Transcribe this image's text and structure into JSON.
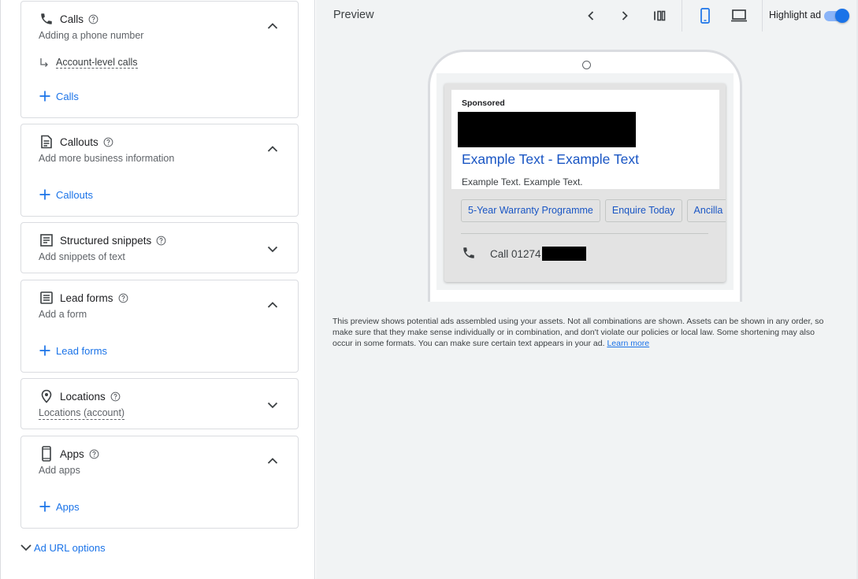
{
  "assets": {
    "calls": {
      "title": "Calls",
      "subtitle": "Adding a phone number",
      "sub_link": "Account-level calls",
      "add_label": "Calls"
    },
    "callouts": {
      "title": "Callouts",
      "subtitle": "Add more business information",
      "add_label": "Callouts"
    },
    "structured_snippets": {
      "title": "Structured snippets",
      "subtitle": "Add snippets of text"
    },
    "lead_forms": {
      "title": "Lead forms",
      "subtitle": "Add a form",
      "add_label": "Lead forms"
    },
    "locations": {
      "title": "Locations",
      "subtitle": "Locations (account)"
    },
    "apps": {
      "title": "Apps",
      "subtitle": "Add apps",
      "add_label": "Apps"
    },
    "ad_url_options": "Ad URL options"
  },
  "preview": {
    "title": "Preview",
    "highlight_label": "Highlight ad",
    "highlight_on": true,
    "ad": {
      "sponsored": "Sponsored",
      "headline": "Example Text - Example Text",
      "description": "Example Text. Example Text.",
      "chips": [
        "5-Year Warranty Programme",
        "Enquire Today",
        "Ancilla"
      ],
      "call_text": "Call 01274"
    },
    "disclaimer": "This preview shows potential ads assembled using your assets. Not all combinations are shown. Assets can be shown in any order, so make sure that they make sense individually or in combination, and don't violate our policies or local law. Some shortening may also occur in some formats. You can make sure certain text appears in your ad.",
    "learn_more": "Learn more"
  },
  "colors": {
    "accent": "#1a73e8",
    "link": "#1a56c4",
    "panel_bg": "#f1f3f4",
    "border": "#dadce0"
  },
  "icons": {
    "calls": "phone-icon",
    "callouts": "callout-doc-icon",
    "structured_snippets": "snippet-doc-icon",
    "lead_forms": "form-icon",
    "locations": "location-pin-icon",
    "apps": "mobile-app-icon",
    "toolbar": [
      "chevron-left-icon",
      "chevron-right-icon",
      "columns-view-icon",
      "mobile-device-icon",
      "desktop-device-icon"
    ]
  }
}
